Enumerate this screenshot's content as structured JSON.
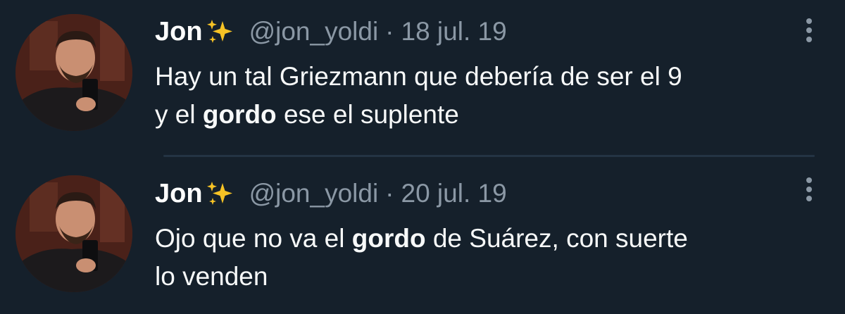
{
  "colors": {
    "background": "#15202b",
    "primary_text": "#ffffff",
    "secondary_text": "#8b98a5",
    "divider": "#243444"
  },
  "tweets": [
    {
      "display_name": "Jon",
      "name_emoji": "sparkles-emoji",
      "handle": "@jon_yoldi",
      "separator": "·",
      "date": "18 jul. 19",
      "text_line1": "Hay un tal Griezmann que debería de ser el 9",
      "text_line2_start": "y el ",
      "text_line2_bold": "gordo",
      "text_line2_end": " ese el suplente",
      "more_icon": "more-options-icon"
    },
    {
      "display_name": "Jon",
      "name_emoji": "sparkles-emoji",
      "handle": "@jon_yoldi",
      "separator": "·",
      "date": "20 jul. 19",
      "text_line1_start": "Ojo que no va el ",
      "text_line1_bold": "gordo",
      "text_line1_end": " de Suárez, con suerte",
      "text_line2": "lo venden",
      "more_icon": "more-options-icon"
    }
  ]
}
